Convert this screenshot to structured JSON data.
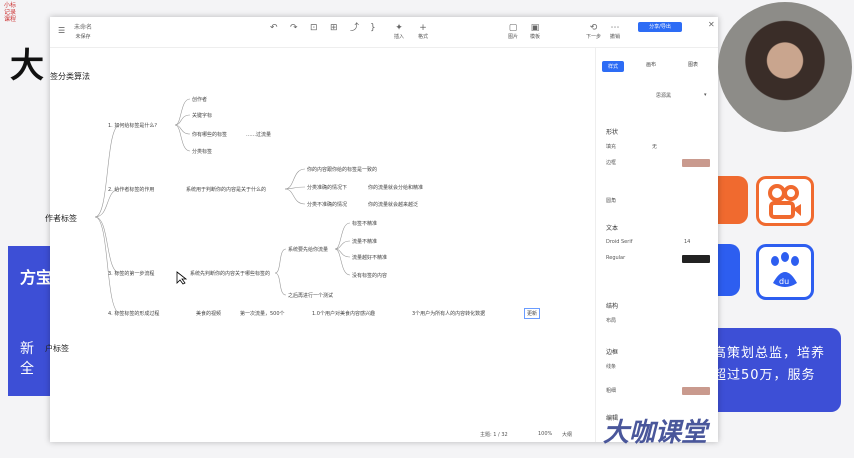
{
  "slide": {
    "top_text": "小标\n记录\n课程",
    "title": "大",
    "left_badge_1": "方宝",
    "left_badge_2": "新\n全",
    "right_box_line1": "高策划总监，培养",
    "right_box_line2": "超过50万，服务"
  },
  "toolbar": {
    "doc_title": "未命名",
    "doc_sub": "未保存",
    "items": [
      "插入",
      "格式",
      "下一步",
      "撤销"
    ],
    "right_items": [
      "图片",
      "模板"
    ],
    "share_label": "分享/导出",
    "close_icon": "✕"
  },
  "mindmap": {
    "root_label": "签分类算法",
    "branch_author": "作者标签",
    "branch_user": "户标签",
    "n1": "1. 如何给标签是什么?",
    "n1_children": [
      "创作者",
      "关键字标",
      "你有哪些的标签",
      "分类标签"
    ],
    "n1_extra": "……过流量",
    "n2": "2. 给作者标签的作用",
    "n2_sub": "系统用于判断你的内容是关于什么的",
    "n2_children": [
      "你的内容跟你给的标签是一致的",
      "分类准确的情况下",
      "分类不准确的情况"
    ],
    "n2_extra": [
      "你的流量就会分给和精准",
      "你的流量就会越来越泛"
    ],
    "n3": "3. 标签的第一步流程",
    "n3_sub": "系统先判断你的内容关于哪些标签的",
    "n3_mid": "系统要先给你流量",
    "n3_children": [
      "标签不精准",
      "流量不精准",
      "流量越好不精准",
      "没有标签的内容"
    ],
    "n3_bottom": "之后再进行一个测试",
    "n4": "4. 标签标签的形成过程",
    "n4_chain": [
      "美食的视频",
      "第一次流量，500个",
      "1.0个用户对美食内容感兴趣",
      "3个用户为所有人的内容转化数据"
    ],
    "n4_end": "更新"
  },
  "status": {
    "text": "主题: 1 / 32",
    "zoom": "100%",
    "mode": "大纲"
  },
  "panel": {
    "tabs": [
      "样式",
      "画布",
      "图表"
    ],
    "font_select": "思源黑",
    "sections": [
      "形状",
      "文本",
      "结构",
      "边框",
      "编辑"
    ],
    "rows": [
      "填充",
      "边框",
      "无",
      "圆角",
      "Droid Serif",
      "Regular",
      "布局",
      "线条",
      "粗细"
    ],
    "font_size": "14",
    "colors": {
      "accent": "#2d6cf5",
      "swatch_pink": "#c99a8e",
      "swatch_dark": "#222222"
    }
  },
  "watermark": "大咖课堂"
}
